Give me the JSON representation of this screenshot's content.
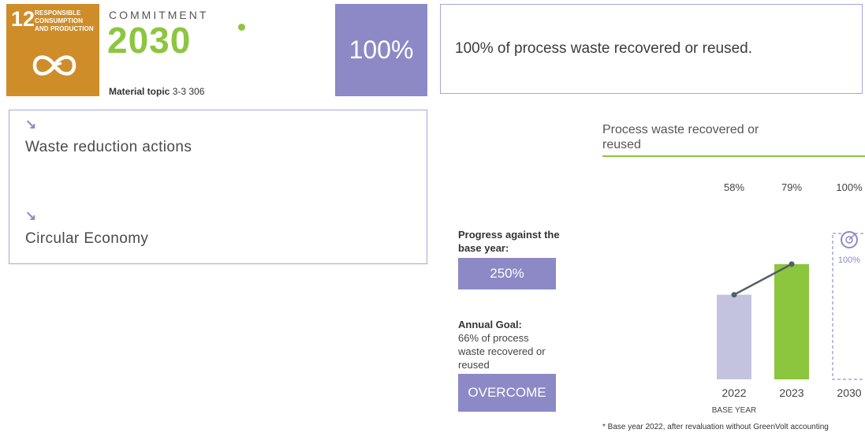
{
  "sdg": {
    "number": "12",
    "title_lines": [
      "RESPONSIBLE",
      "CONSUMPTION",
      "AND PRODUCTION"
    ],
    "icon": "infinity-arrow-icon",
    "color": "#cf8d2a"
  },
  "commitment": {
    "label": "COMMITMENT",
    "year": "2030",
    "color": "#8cc63f"
  },
  "material_topic": {
    "label": "Material topic",
    "value": "3-3 306"
  },
  "target": {
    "percent": "100%",
    "description": "100% of process waste recovered or reused."
  },
  "links": [
    {
      "label": "Waste reduction actions",
      "icon": "arrow-down-right-icon"
    },
    {
      "label": "Circular Economy",
      "icon": "arrow-down-right-icon"
    }
  ],
  "progress": {
    "label": "Progress against the base year:",
    "value": "250%"
  },
  "annual_goal": {
    "label": "Annual Goal:",
    "description": "66% of process waste recovered or reused",
    "status": "OVERCOME"
  },
  "chart_data": {
    "type": "bar",
    "title": "Process waste recovered or reused",
    "categories": [
      "2022",
      "2023",
      "2030"
    ],
    "values": [
      58,
      79,
      100
    ],
    "value_labels": [
      "58%",
      "79%",
      "100%"
    ],
    "sublabels": [
      "BASE YEAR",
      "",
      ""
    ],
    "target_label": "100%",
    "target_icon": "target-icon",
    "colors": [
      "#c3c3df",
      "#8cc63f",
      "#a8a6d8"
    ],
    "ylim": [
      0,
      100
    ]
  },
  "footnote": "* Base year 2022, after revaluation without GreenVolt accounting"
}
